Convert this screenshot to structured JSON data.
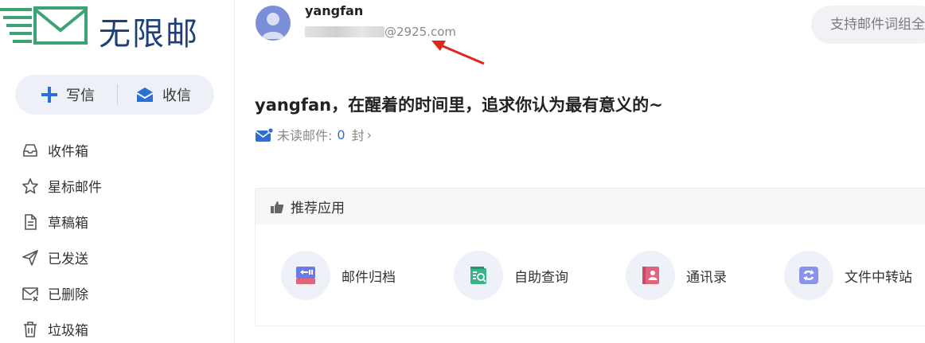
{
  "brand": {
    "name": "无限邮"
  },
  "compose": {
    "write_label": "写信",
    "receive_label": "收信"
  },
  "folders": [
    {
      "label": "收件箱",
      "icon": "inbox-icon"
    },
    {
      "label": "星标邮件",
      "icon": "star-icon"
    },
    {
      "label": "草稿箱",
      "icon": "draft-icon"
    },
    {
      "label": "已发送",
      "icon": "sent-icon"
    },
    {
      "label": "已删除",
      "icon": "deleted-mail-icon"
    },
    {
      "label": "垃圾箱",
      "icon": "trash-icon"
    }
  ],
  "user": {
    "name": "yangfan",
    "email_domain": "@2925.com"
  },
  "search": {
    "placeholder": "支持邮件词组全文搜索"
  },
  "greeting": "yangfan，在醒着的时间里，追求你认为最有意义的~",
  "unread": {
    "label": "未读邮件:",
    "count": "0",
    "unit": "封",
    "chevron": "›"
  },
  "apps": {
    "title": "推荐应用",
    "items": [
      {
        "label": "邮件归档",
        "icon": "archive-icon"
      },
      {
        "label": "自助查询",
        "icon": "self-query-icon"
      },
      {
        "label": "通讯录",
        "icon": "contacts-icon"
      },
      {
        "label": "文件中转站",
        "icon": "file-transfer-icon"
      }
    ]
  },
  "colors": {
    "accent": "#2b6fd6",
    "brand_text": "#1f3f78",
    "logo_green": "#3ba374",
    "annotation_arrow": "#e0261b"
  }
}
